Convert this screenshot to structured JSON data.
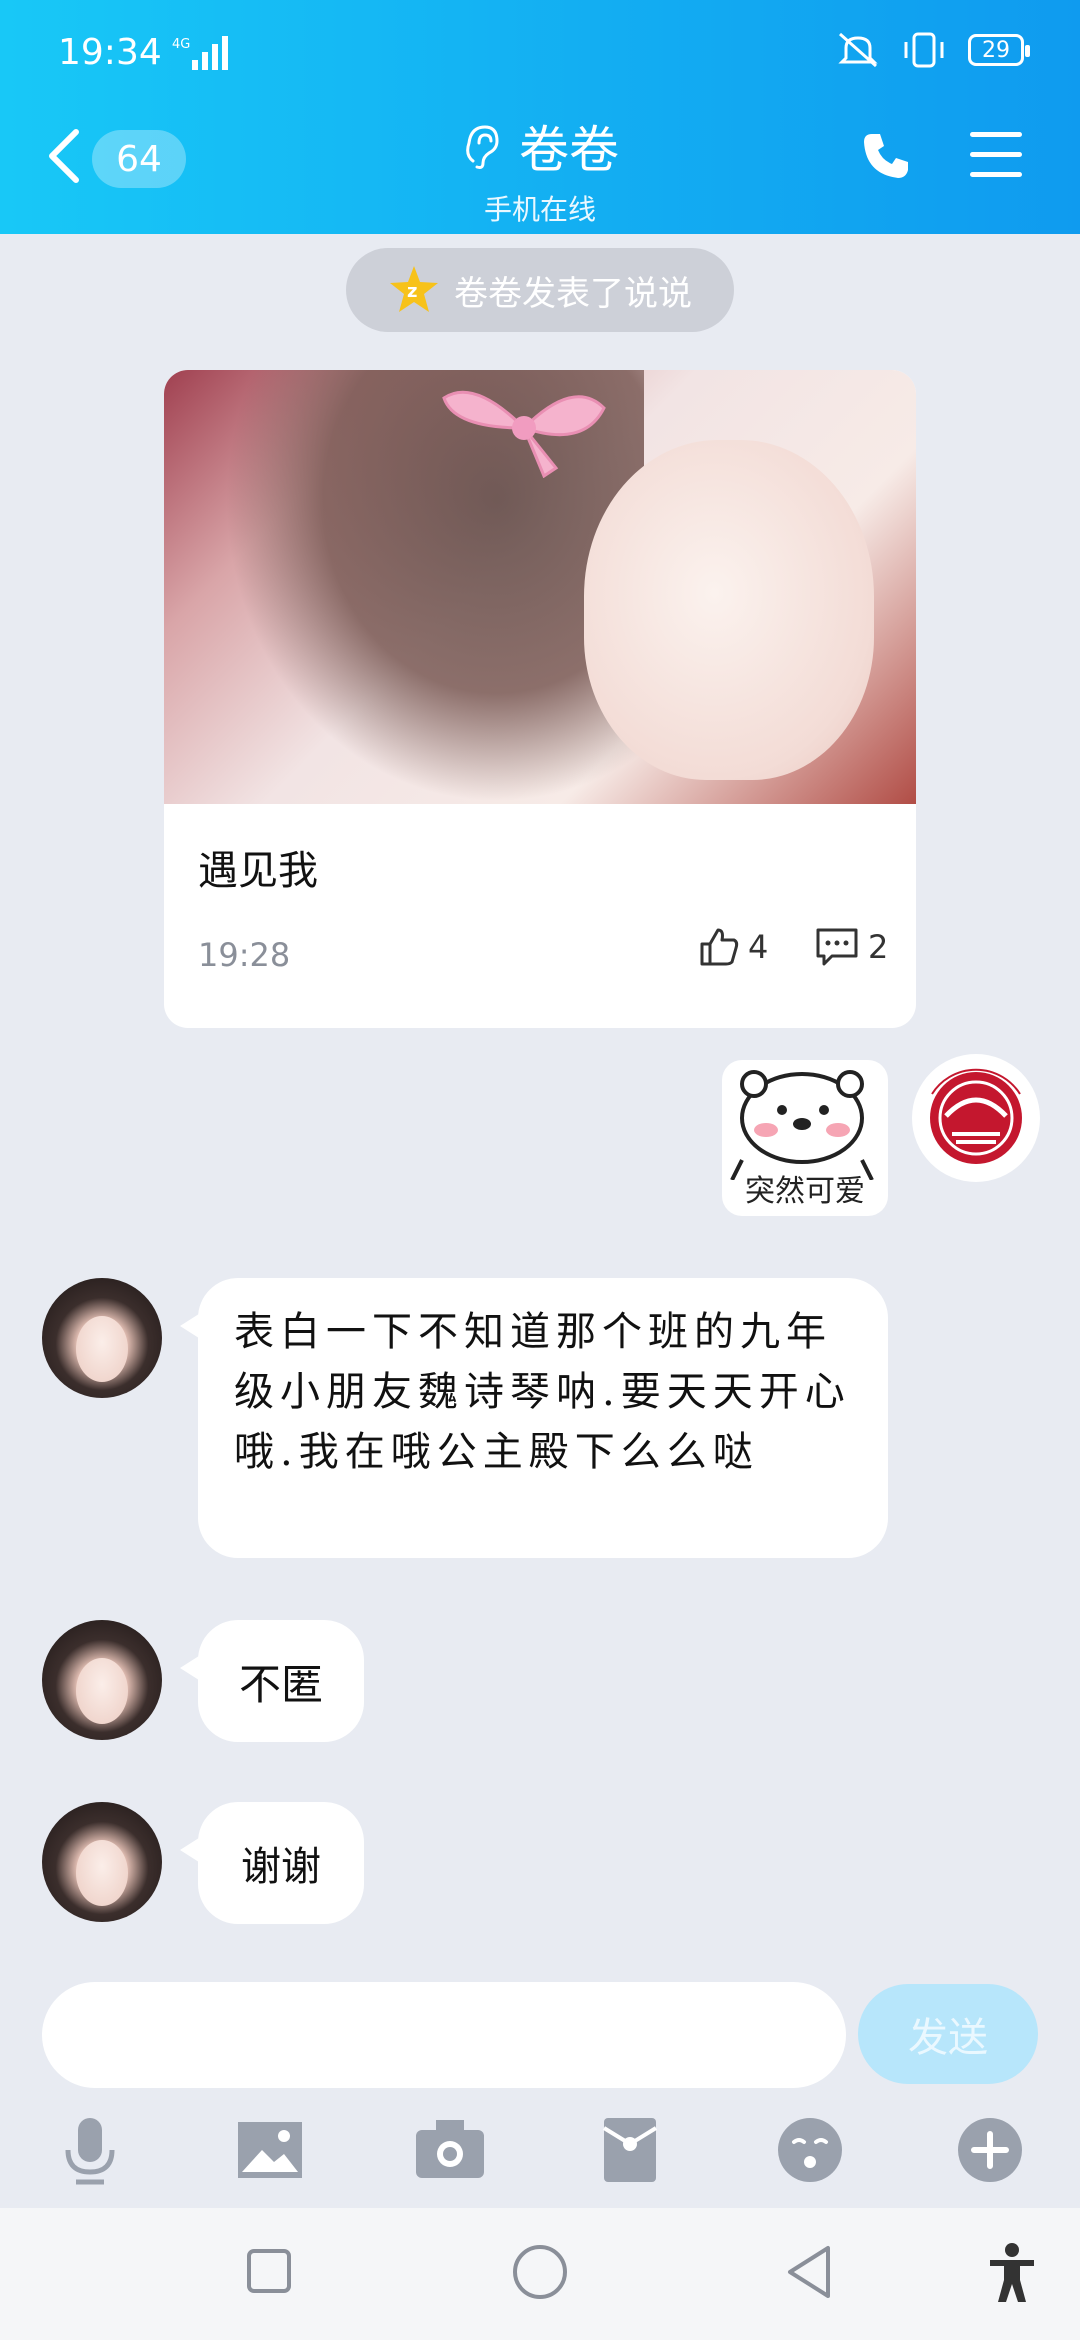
{
  "status_bar": {
    "time": "19:34",
    "network": "4G",
    "battery": "29"
  },
  "header": {
    "unread_count": "64",
    "contact_name": "卷卷",
    "contact_status": "手机在线"
  },
  "system_notice": {
    "text": "卷卷发表了说说"
  },
  "post_card": {
    "caption": "遇见我",
    "time": "19:28",
    "likes": "4",
    "comments": "2"
  },
  "sticker": {
    "caption": "突然可爱"
  },
  "messages": [
    {
      "text": "表白一下不知道那个班的九年级小朋友魏诗琴呐.要天天开心哦.我在哦公主殿下么么哒"
    },
    {
      "text": "不匿"
    },
    {
      "text": "谢谢"
    }
  ],
  "composer": {
    "send_label": "发送",
    "placeholder": ""
  },
  "colors": {
    "header": "#13aef2",
    "background": "#e8ebf2",
    "send_disabled": "#b7e6fb"
  },
  "icons": [
    "back-icon",
    "ear-icon",
    "phone-icon",
    "menu-icon",
    "qzone-star-icon",
    "thumbs-up-icon",
    "comment-icon",
    "microphone-icon",
    "image-icon",
    "camera-icon",
    "red-packet-icon",
    "emoji-icon",
    "plus-icon",
    "square-nav-icon",
    "circle-nav-icon",
    "triangle-nav-icon",
    "accessibility-icon"
  ]
}
